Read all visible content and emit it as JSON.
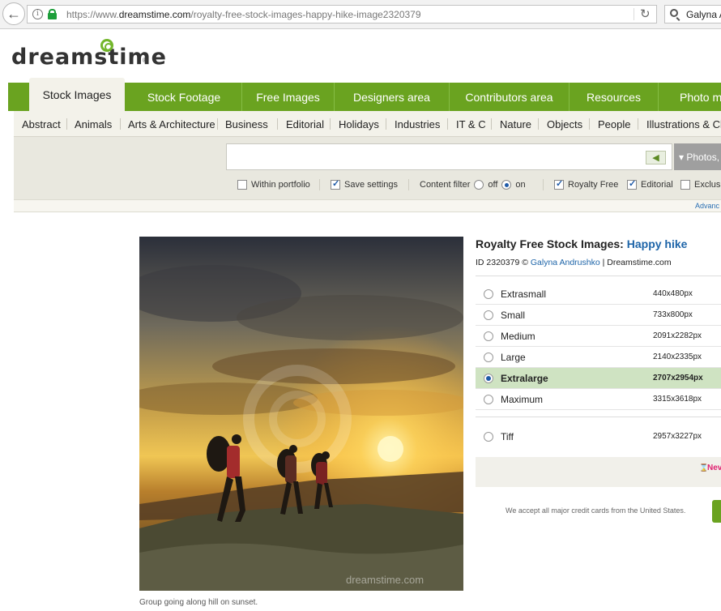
{
  "browser": {
    "url_prefix": "https://www.",
    "url_domain": "dreamstime.com",
    "url_path": "/royalty-free-stock-images-happy-hike-image2320379",
    "search_text": "Galyna A"
  },
  "logo": {
    "text": "dreamstime",
    "reg": "®"
  },
  "topnav": {
    "tabs": [
      "Stock Images",
      "Stock Footage",
      "Free Images",
      "Designers area",
      "Contributors area",
      "Resources",
      "Photo m"
    ]
  },
  "subnav": {
    "items": [
      "Abstract",
      "Animals",
      "Arts & Architecture",
      "Business",
      "Editorial",
      "Holidays",
      "Industries",
      "IT & C",
      "Nature",
      "Objects",
      "People",
      "Illustrations & Cli"
    ]
  },
  "search": {
    "type_select": "▾ Photos, illu",
    "go_icon": "left-arrow-icon"
  },
  "options": {
    "within_portfolio": "Within portfolio",
    "save_settings": "Save settings",
    "content_filter": "Content filter",
    "off": "off",
    "on": "on",
    "royalty_free": "Royalty Free",
    "editorial": "Editorial",
    "exclusive": "Exclus"
  },
  "advanced_link": "Advanc",
  "image": {
    "watermark": "dreamstime.com",
    "caption": "Group going along hill on sunset."
  },
  "details": {
    "title_prefix": "Royalty Free Stock Images: ",
    "title_highlight": "Happy hike",
    "id_prefix": "ID 2320379 © ",
    "author": "Galyna Andrushko",
    "id_suffix": " | Dreamstime.com"
  },
  "sizes": [
    {
      "name": "Extrasmall",
      "dim": "440x480px",
      "selected": false
    },
    {
      "name": "Small",
      "dim": "733x800px",
      "selected": false
    },
    {
      "name": "Medium",
      "dim": "2091x2282px",
      "selected": false
    },
    {
      "name": "Large",
      "dim": "2140x2335px",
      "selected": false
    },
    {
      "name": "Extralarge",
      "dim": "2707x2954px",
      "selected": true
    },
    {
      "name": "Maximum",
      "dim": "3315x3618px",
      "selected": false
    },
    {
      "name": "Tiff",
      "dim": "2957x3227px",
      "selected": false
    }
  ],
  "new_label": "Nev",
  "cards_text": "We accept all major credit cards from the United States.",
  "colors": {
    "green": "#6aa320",
    "link": "#1d64a8",
    "selected_row": "#cfe3c2"
  }
}
